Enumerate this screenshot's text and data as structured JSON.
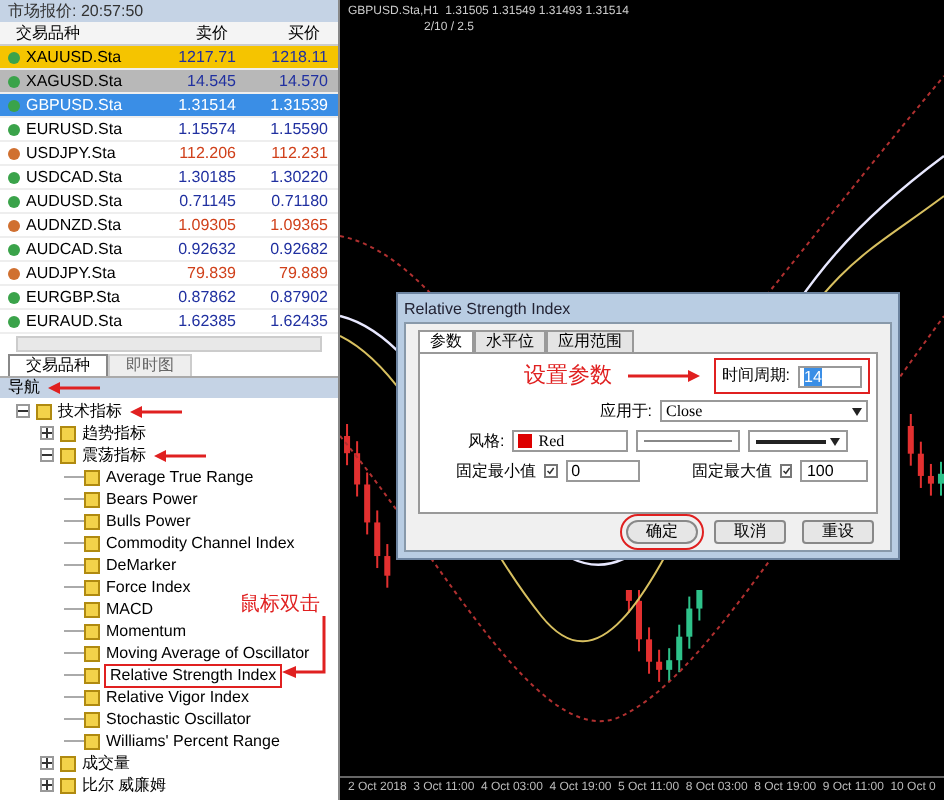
{
  "market_watch": {
    "title": "市场报价: 20:57:50",
    "columns": [
      "交易品种",
      "卖价",
      "买价"
    ],
    "rows": [
      {
        "symbol": "XAUUSD.Sta",
        "bid": "1217.71",
        "ask": "1218.11",
        "down": false,
        "flash": true,
        "dim": false,
        "selected": false
      },
      {
        "symbol": "XAGUSD.Sta",
        "bid": "14.545",
        "ask": "14.570",
        "down": false,
        "flash": false,
        "dim": true,
        "selected": false
      },
      {
        "symbol": "GBPUSD.Sta",
        "bid": "1.31514",
        "ask": "1.31539",
        "down": false,
        "flash": false,
        "dim": false,
        "selected": true
      },
      {
        "symbol": "EURUSD.Sta",
        "bid": "1.15574",
        "ask": "1.15590",
        "down": false,
        "flash": false,
        "dim": false,
        "selected": false
      },
      {
        "symbol": "USDJPY.Sta",
        "bid": "112.206",
        "ask": "112.231",
        "down": true,
        "flash": false,
        "dim": false,
        "selected": false
      },
      {
        "symbol": "USDCAD.Sta",
        "bid": "1.30185",
        "ask": "1.30220",
        "down": false,
        "flash": false,
        "dim": false,
        "selected": false
      },
      {
        "symbol": "AUDUSD.Sta",
        "bid": "0.71145",
        "ask": "0.71180",
        "down": false,
        "flash": false,
        "dim": false,
        "selected": false
      },
      {
        "symbol": "AUDNZD.Sta",
        "bid": "1.09305",
        "ask": "1.09365",
        "down": true,
        "flash": false,
        "dim": false,
        "selected": false
      },
      {
        "symbol": "AUDCAD.Sta",
        "bid": "0.92632",
        "ask": "0.92682",
        "down": false,
        "flash": false,
        "dim": false,
        "selected": false
      },
      {
        "symbol": "AUDJPY.Sta",
        "bid": "79.839",
        "ask": "79.889",
        "down": true,
        "flash": false,
        "dim": false,
        "selected": false
      },
      {
        "symbol": "EURGBP.Sta",
        "bid": "0.87862",
        "ask": "0.87902",
        "down": false,
        "flash": false,
        "dim": false,
        "selected": false
      },
      {
        "symbol": "EURAUD.Sta",
        "bid": "1.62385",
        "ask": "1.62435",
        "down": false,
        "flash": false,
        "dim": false,
        "selected": false
      }
    ],
    "tabs": [
      {
        "label": "交易品种",
        "selected": true
      },
      {
        "label": "即时图",
        "selected": false
      }
    ]
  },
  "navigator": {
    "title": "导航",
    "annotated": true,
    "tree": [
      {
        "label": "技术指标",
        "expanded": true,
        "annotated": true,
        "children": [
          {
            "label": "趋势指标",
            "expanded": false,
            "annotated": false
          },
          {
            "label": "震荡指标",
            "expanded": true,
            "annotated": true,
            "children": [
              {
                "label": "Average True Range",
                "annotated": false
              },
              {
                "label": "Bears Power",
                "annotated": false
              },
              {
                "label": "Bulls Power",
                "annotated": false
              },
              {
                "label": "Commodity Channel Index",
                "annotated": false
              },
              {
                "label": "DeMarker",
                "annotated": false
              },
              {
                "label": "Force Index",
                "annotated": false
              },
              {
                "label": "MACD",
                "annotated": false
              },
              {
                "label": "Momentum",
                "annotated": false
              },
              {
                "label": "Moving Average of Oscillator",
                "annotated": false
              },
              {
                "label": "Relative Strength Index",
                "annotated": true
              },
              {
                "label": "Relative Vigor Index",
                "annotated": false
              },
              {
                "label": "Stochastic Oscillator",
                "annotated": false
              },
              {
                "label": "Williams' Percent Range",
                "annotated": false
              }
            ]
          },
          {
            "label": "成交量",
            "expanded": false,
            "annotated": false
          },
          {
            "label": "比尔 威廉姆",
            "expanded": false,
            "annotated": false
          }
        ]
      }
    ]
  },
  "chart": {
    "title": "GBPUSD.Sta,H1  1.31505 1.31549 1.31493 1.31514",
    "subtitle": "2/10 / 2.5",
    "time_labels": [
      "2 Oct 2018",
      "3 Oct 11:00",
      "4 Oct 03:00",
      "4 Oct 19:00",
      "5 Oct 11:00",
      "8 Oct 03:00",
      "8 Oct 19:00",
      "9 Oct 11:00",
      "10 Oct 0"
    ]
  },
  "dialog": {
    "title": "Relative Strength Index",
    "tabs": [
      {
        "label": "参数",
        "selected": true
      },
      {
        "label": "水平位",
        "selected": false
      },
      {
        "label": "应用范围",
        "selected": false
      }
    ],
    "period_label": "时间周期:",
    "period_value": "14",
    "apply_label": "应用于:",
    "apply_value": "Close",
    "style_label": "风格:",
    "style_color": "Red",
    "color": "#dd0000",
    "min_label": "固定最小值",
    "min_checked": true,
    "min_value": "0",
    "max_label": "固定最大值",
    "max_checked": true,
    "max_value": "100",
    "buttons": [
      {
        "label": "确定",
        "annotated": true
      },
      {
        "label": "取消",
        "annotated": false
      },
      {
        "label": "重设",
        "annotated": false
      }
    ]
  },
  "annotations": {
    "set_params": "设置参数",
    "double_click": "鼠标双击"
  }
}
